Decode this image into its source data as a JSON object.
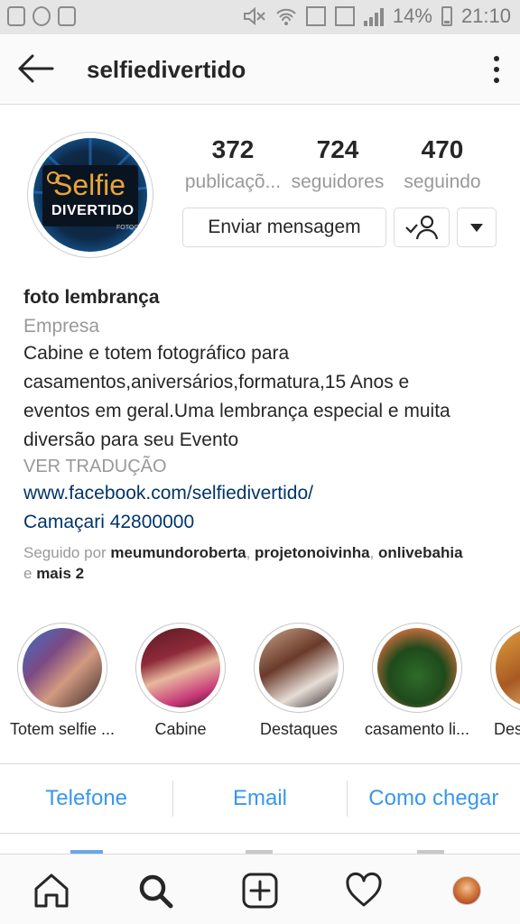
{
  "status_bar": {
    "battery_percent": "14%",
    "time": "21:10"
  },
  "header": {
    "username": "selfiedivertido"
  },
  "profile": {
    "avatar_text_1": "Selfie",
    "avatar_text_2": "DIVERTIDO",
    "avatar_text_3": "FOTOCA",
    "stats": [
      {
        "value": "372",
        "label": "publicaçõ..."
      },
      {
        "value": "724",
        "label": "seguidores"
      },
      {
        "value": "470",
        "label": "seguindo"
      }
    ],
    "message_button": "Enviar mensagem"
  },
  "bio": {
    "name": "foto lembrança",
    "category": "Empresa",
    "lines": [
      "Cabine e totem fotográfico  para",
      "casamentos,aniversários,formatura,15 Anos e",
      "eventos em geral.Uma lembrança especial e muita",
      "diversão para seu Evento"
    ],
    "translate": "VER TRADUÇÃO",
    "link": "www.facebook.com/selfiedivertido/",
    "address": "Camaçari 42800000",
    "followed_prefix": "Seguido por ",
    "followed_users": [
      "meumundoroberta",
      "projetonoivinha",
      "onlivebahia"
    ],
    "followed_and": "e ",
    "followed_more": "mais 2"
  },
  "highlights": [
    {
      "label": "Totem selfie ..."
    },
    {
      "label": "Cabine"
    },
    {
      "label": "Destaques"
    },
    {
      "label": "casamento li..."
    },
    {
      "label": "Des"
    }
  ],
  "contact": {
    "phone": "Telefone",
    "email": "Email",
    "directions": "Como chegar"
  },
  "colors": {
    "accent": "#3897f0",
    "link": "#003569",
    "muted": "#999999"
  },
  "icons": {
    "back": "arrow-left-icon",
    "menu": "more-vertical-icon",
    "follow": "person-check-icon",
    "dropdown": "caret-down-icon",
    "nav": [
      "home-icon",
      "search-icon",
      "add-post-icon",
      "heart-icon",
      "profile-avatar"
    ]
  }
}
